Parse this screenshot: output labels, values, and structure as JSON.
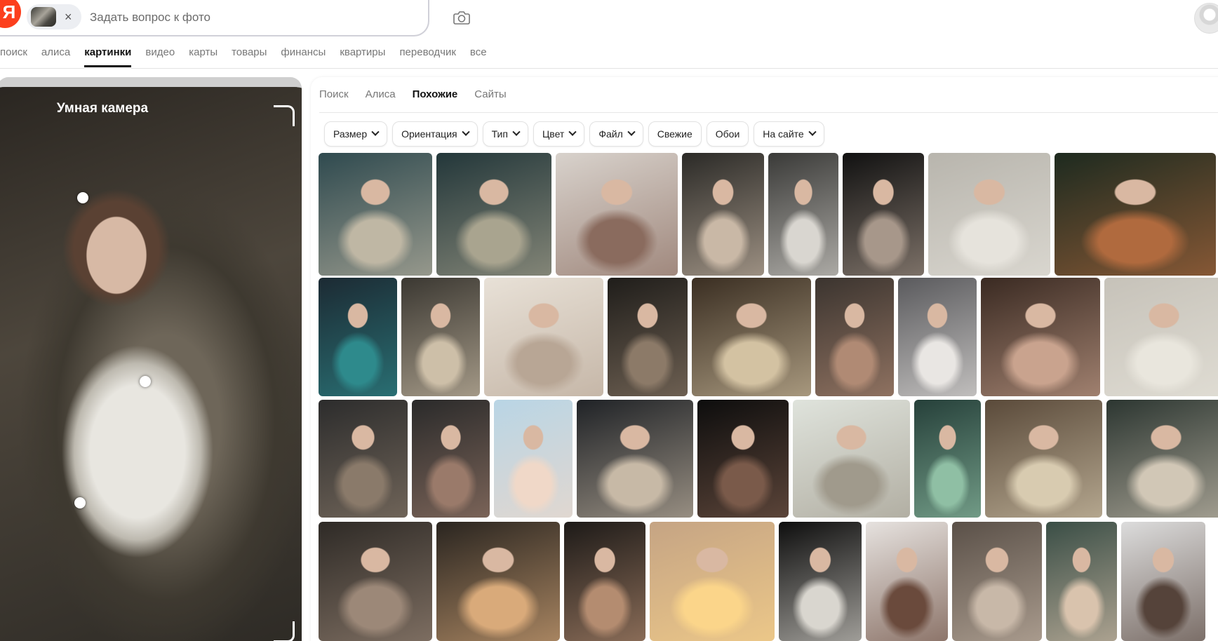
{
  "header": {
    "logo_letter": "Я",
    "search_placeholder": "Задать вопрос к фото",
    "chip_close": "×"
  },
  "services": [
    "поиск",
    "алиса",
    "картинки",
    "видео",
    "карты",
    "товары",
    "финансы",
    "квартиры",
    "переводчик",
    "все"
  ],
  "viewer": {
    "title": "Умная камера"
  },
  "results": {
    "tabs": [
      "Поиск",
      "Алиса",
      "Похожие",
      "Сайты"
    ],
    "active_tab": "Похожие",
    "filters": [
      {
        "label": "Размер",
        "dropdown": true
      },
      {
        "label": "Ориентация",
        "dropdown": true
      },
      {
        "label": "Тип",
        "dropdown": true
      },
      {
        "label": "Цвет",
        "dropdown": true
      },
      {
        "label": "Файл",
        "dropdown": true
      },
      {
        "label": "Свежие",
        "dropdown": false
      },
      {
        "label": "Обои",
        "dropdown": false
      },
      {
        "label": "На сайте",
        "dropdown": true
      }
    ]
  },
  "colors": {
    "brand_red": "#fc3f1d",
    "thumb_palettes": [
      [
        "#2f4a4f",
        "#bfb7a4"
      ],
      [
        "#23373a",
        "#a9a48f"
      ],
      [
        "#d8d2cc",
        "#8a6b5e"
      ],
      [
        "#2b2a27",
        "#c9b8a6"
      ],
      [
        "#3a3a38",
        "#d9d6d0"
      ],
      [
        "#111111",
        "#a7978a"
      ],
      [
        "#b8b5ad",
        "#e6e3dc"
      ],
      [
        "#1d2a1f",
        "#b06a3e"
      ],
      [
        "#1c2a33",
        "#2e8a8c"
      ],
      [
        "#3b3832",
        "#cdbfa8"
      ],
      [
        "#e8e1d7",
        "#b8a695"
      ],
      [
        "#1f1d1a",
        "#8c7a68"
      ],
      [
        "#3a2e22",
        "#d3c2a2"
      ],
      [
        "#3b342f",
        "#b08a74"
      ],
      [
        "#5a5a5d",
        "#e9e6e3"
      ],
      [
        "#3a2a22",
        "#c9a38e"
      ],
      [
        "#c6c2b9",
        "#e9e6dd"
      ],
      [
        "#2c2c2c",
        "#8a7a6a"
      ],
      [
        "#2a2a2a",
        "#9a7a6a"
      ],
      [
        "#b9d5e5",
        "#f0d8c8"
      ],
      [
        "#1f2226",
        "#c7b9a6"
      ],
      [
        "#0d0d0d",
        "#7a5a4a"
      ],
      [
        "#dfe3dc",
        "#a09a8c"
      ],
      [
        "#26403a",
        "#8fbfa4"
      ],
      [
        "#5a4a3a",
        "#d8cbb0"
      ],
      [
        "#2c3631",
        "#d1c7b6"
      ],
      [
        "#2e2a26",
        "#9c8878"
      ],
      [
        "#2a2520",
        "#d9aa7a"
      ],
      [
        "#1d1a18",
        "#b48c70"
      ],
      [
        "#c5a484",
        "#fbd58a"
      ],
      [
        "#0e0e0e",
        "#d9d6cf"
      ],
      [
        "#e6e2df",
        "#6a4a3c"
      ],
      [
        "#5a5048",
        "#c8b8a8"
      ],
      [
        "#3a4e46",
        "#d9c3ad"
      ],
      [
        "#dcdcdc",
        "#55433a"
      ]
    ]
  }
}
